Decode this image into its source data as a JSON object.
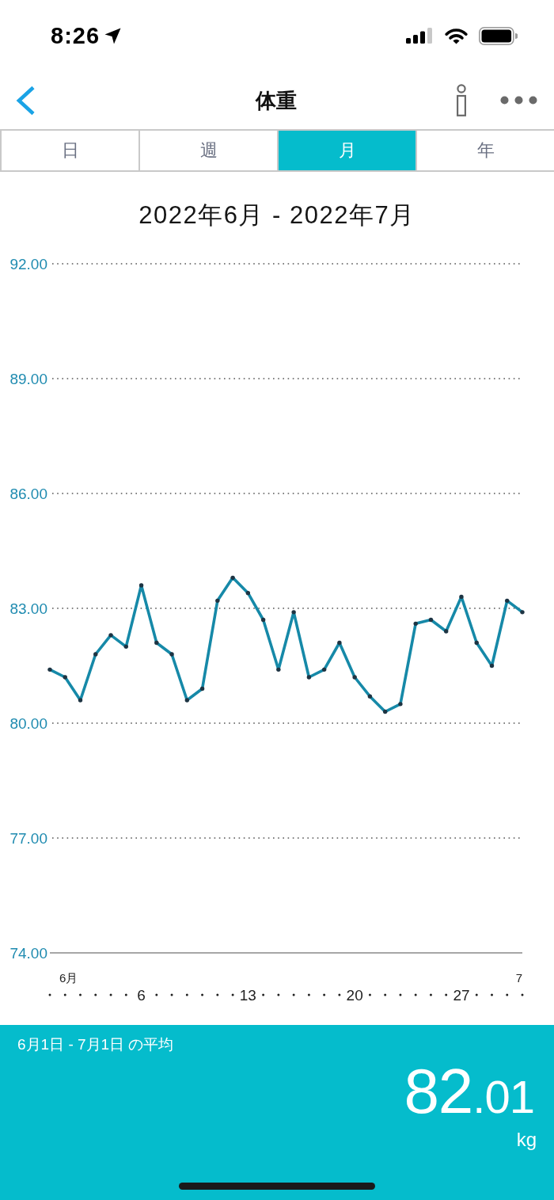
{
  "status_bar": {
    "time": "8:26"
  },
  "nav_bar": {
    "title": "体重"
  },
  "tabs": [
    {
      "label": "日",
      "selected": false
    },
    {
      "label": "週",
      "selected": false
    },
    {
      "label": "月",
      "selected": true
    },
    {
      "label": "年",
      "selected": false
    }
  ],
  "period_title": "2022年6月 - 2022年7月",
  "chart": {
    "chart_data": {
      "type": "line",
      "x": [
        0,
        1,
        2,
        3,
        4,
        5,
        6,
        7,
        8,
        9,
        10,
        11,
        12,
        13,
        14,
        15,
        16,
        17,
        18,
        19,
        20,
        21,
        22,
        23,
        24,
        25,
        26,
        27,
        28,
        29,
        30,
        31
      ],
      "series": [
        {
          "color": "#1689a8",
          "values": [
            81.4,
            81.2,
            80.6,
            81.8,
            82.3,
            82.0,
            83.6,
            82.1,
            81.8,
            80.6,
            80.9,
            83.2,
            83.8,
            83.4,
            82.7,
            81.4,
            82.9,
            81.2,
            81.4,
            82.1,
            81.2,
            80.7,
            80.3,
            80.5,
            82.6,
            82.7,
            82.4,
            83.3,
            82.1,
            81.5,
            83.2,
            82.9
          ]
        }
      ],
      "xlim": [
        0,
        31
      ],
      "ylim": [
        74,
        92
      ],
      "xticks": [
        {
          "value": 6,
          "label": "6"
        },
        {
          "value": 13,
          "label": "13"
        },
        {
          "value": 20,
          "label": "20"
        },
        {
          "value": 27,
          "label": "27"
        }
      ],
      "yticks": [
        {
          "value": 92,
          "label": "92.00"
        },
        {
          "value": 89,
          "label": "89.00"
        },
        {
          "value": 86,
          "label": "86.00"
        },
        {
          "value": 83,
          "label": "83.00"
        },
        {
          "value": 80,
          "label": "80.00"
        },
        {
          "value": 77,
          "label": "77.00"
        },
        {
          "value": 74,
          "label": "74.00"
        }
      ],
      "grid": true
    },
    "month_labels": [
      "6月",
      "7"
    ]
  },
  "summary": {
    "label": "6月1日 - 7月1日 の平均",
    "value": "82.01",
    "unit": "kg"
  }
}
